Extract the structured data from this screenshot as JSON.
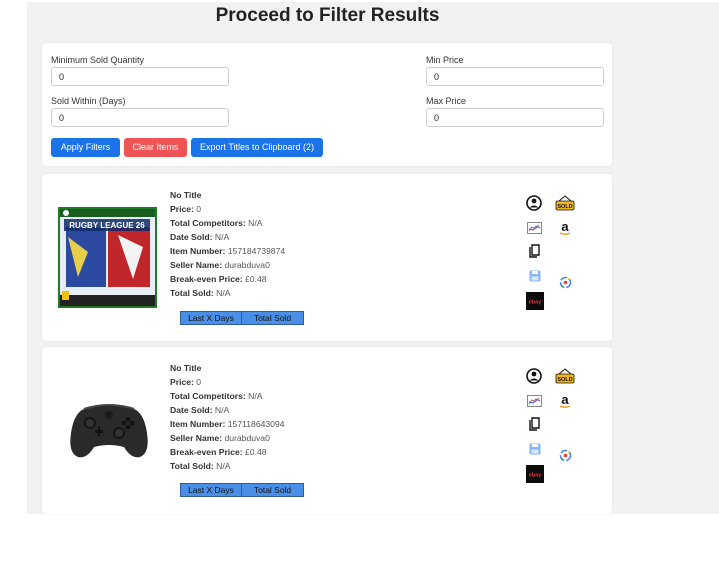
{
  "page": {
    "title": "Proceed to Filter Results"
  },
  "filters": {
    "min_sold_label": "Minimum Sold Quantity",
    "min_sold_value": "0",
    "sold_within_label": "Sold Within (Days)",
    "sold_within_value": "0",
    "min_price_label": "Min Price",
    "min_price_value": "0",
    "max_price_label": "Max Price",
    "max_price_value": "0",
    "apply_label": "Apply Filters",
    "clear_label": "Clear Items",
    "export_label": "Export Titles to Clipboard (2)"
  },
  "labels": {
    "price": "Price:",
    "competitors": "Total Competitors:",
    "date_sold": "Date Sold:",
    "item_number": "Item Number:",
    "seller_name": "Seller Name:",
    "break_even": "Break-even Price:",
    "total_sold": "Total Sold:",
    "tab_last_days": "Last X Days",
    "tab_total_sold": "Total Sold"
  },
  "items": [
    {
      "title": "No Title",
      "price": "0",
      "competitors": "N/A",
      "date_sold": "N/A",
      "item_number": "157184739874",
      "seller": "durabduva0",
      "break_even": "£0.48",
      "total_sold": "N/A",
      "image": "rugby-league-26-xbox-cover",
      "cover_text": "RUGBY LEAGUE 26"
    },
    {
      "title": "No Title",
      "price": "0",
      "competitors": "N/A",
      "date_sold": "N/A",
      "item_number": "157118643094",
      "seller": "durabduva0",
      "break_even": "£0.48",
      "total_sold": "N/A",
      "image": "xbox-controller"
    }
  ],
  "icons": {
    "sold_badge": "SOLD",
    "amazon_letter": "a",
    "ebay_logo": "ebay"
  },
  "colors": {
    "primary": "#1a73e8",
    "danger": "#f05454",
    "tab": "#4a8fe7",
    "sold_badge": "#f2b51d"
  }
}
